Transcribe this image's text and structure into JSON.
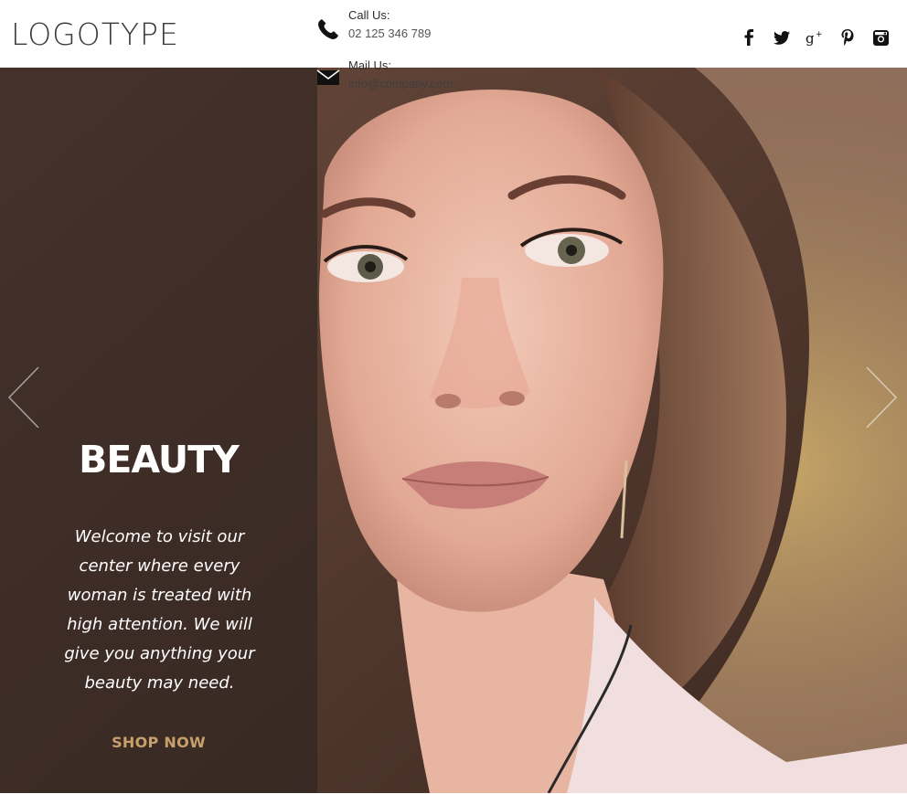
{
  "header": {
    "logo": "LOGOTYPE",
    "call": {
      "title": "Call Us:",
      "value": "02 125 346 789",
      "icon": "phone-icon"
    },
    "mail": {
      "title": "Mail Us:",
      "value": "info@company.com",
      "icon": "envelope-icon"
    },
    "social": [
      {
        "name": "facebook-icon"
      },
      {
        "name": "twitter-icon"
      },
      {
        "name": "google-plus-icon"
      },
      {
        "name": "pinterest-icon"
      },
      {
        "name": "instagram-icon"
      }
    ]
  },
  "hero": {
    "title": "BEAUTY",
    "text": "Welcome to visit our center where every woman is treated with high attention. We will give you anything your beauty may need.",
    "cta": "SHOP NOW",
    "prev_icon": "chevron-left-icon",
    "next_icon": "chevron-right-icon"
  },
  "colors": {
    "cta": "#c8a06b",
    "overlay": "#2d2421",
    "logo": "#3a3a3a"
  }
}
